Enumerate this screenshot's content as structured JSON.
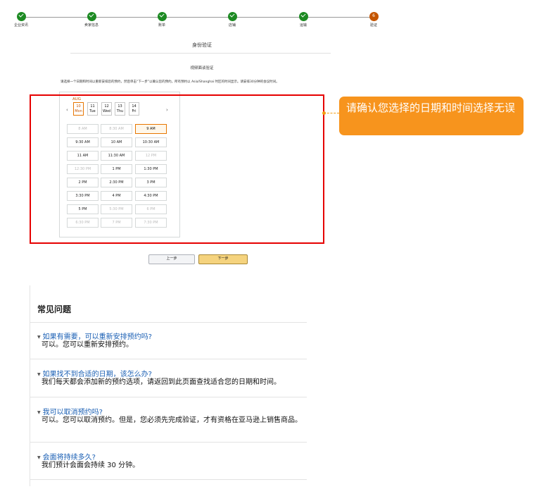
{
  "stepper": {
    "steps": [
      {
        "label": "企业资讯",
        "status": "done"
      },
      {
        "label": "卖家信息",
        "status": "done"
      },
      {
        "label": "账单",
        "status": "done"
      },
      {
        "label": "店铺",
        "status": "done"
      },
      {
        "label": "运输",
        "status": "done"
      },
      {
        "label": "验证",
        "status": "current",
        "number": "6"
      }
    ]
  },
  "section": {
    "title": "身份验证",
    "subtitle": "视频面谈验证",
    "instruction": "请选择一个日期和时间以重新安排您的预约，然后单击“下一步”以确认您的预约。所有预约以 Asia/Shanghai 时区的时间显示。请安排30分钟的会议时间。"
  },
  "calendar": {
    "month": "AUG",
    "prev_arrow": "‹",
    "next_arrow": "›",
    "dates": [
      {
        "day": "10",
        "weekday": "Mon",
        "selected": true
      },
      {
        "day": "11",
        "weekday": "Tue",
        "selected": false
      },
      {
        "day": "12",
        "weekday": "Wed",
        "selected": false
      },
      {
        "day": "13",
        "weekday": "Thu",
        "selected": false
      },
      {
        "day": "14",
        "weekday": "Fri",
        "selected": false
      }
    ],
    "slots": [
      {
        "label": "8 AM",
        "state": "disabled"
      },
      {
        "label": "8:30 AM",
        "state": "disabled"
      },
      {
        "label": "9 AM",
        "state": "selected"
      },
      {
        "label": "9:30 AM",
        "state": "available"
      },
      {
        "label": "10 AM",
        "state": "available"
      },
      {
        "label": "10:30 AM",
        "state": "available"
      },
      {
        "label": "11 AM",
        "state": "available"
      },
      {
        "label": "11:30 AM",
        "state": "available"
      },
      {
        "label": "12 PM",
        "state": "disabled"
      },
      {
        "label": "12:30 PM",
        "state": "disabled"
      },
      {
        "label": "1 PM",
        "state": "available"
      },
      {
        "label": "1:30 PM",
        "state": "available"
      },
      {
        "label": "2 PM",
        "state": "available"
      },
      {
        "label": "2:30 PM",
        "state": "available"
      },
      {
        "label": "3 PM",
        "state": "available"
      },
      {
        "label": "3:30 PM",
        "state": "available"
      },
      {
        "label": "4 PM",
        "state": "available"
      },
      {
        "label": "4:30 PM",
        "state": "available"
      },
      {
        "label": "5 PM",
        "state": "available"
      },
      {
        "label": "5:30 PM",
        "state": "disabled"
      },
      {
        "label": "6 PM",
        "state": "disabled"
      },
      {
        "label": "6:30 PM",
        "state": "disabled"
      },
      {
        "label": "7 PM",
        "state": "disabled"
      },
      {
        "label": "7:30 PM",
        "state": "disabled"
      }
    ]
  },
  "callout": {
    "text": "请确认您选择的日期和时间选择无误"
  },
  "buttons": {
    "prev": "上一步",
    "next": "下一步"
  },
  "faq": {
    "title": "常见问题",
    "items": [
      {
        "q": "如果有需要，可以重新安排预约吗?",
        "a": "可以。您可以重新安排预约。"
      },
      {
        "q": "如果找不到合适的日期，该怎么办?",
        "a": "我们每天都会添加新的预约选项，请返回到此页面查找适合您的日期和时间。"
      },
      {
        "q": "我可以取消预约吗?",
        "a": "可以。您可以取消预约。但是，您必须先完成验证，才有资格在亚马逊上销售商品。"
      },
      {
        "q": "会面将持续多久?",
        "a": "我们预计会面会持续 30 分钟。"
      }
    ]
  },
  "colors": {
    "done": "#1c8a22",
    "current": "#c45500",
    "callout": "#f7941d",
    "highlight": "#e60000",
    "link": "#1a5fb4"
  }
}
